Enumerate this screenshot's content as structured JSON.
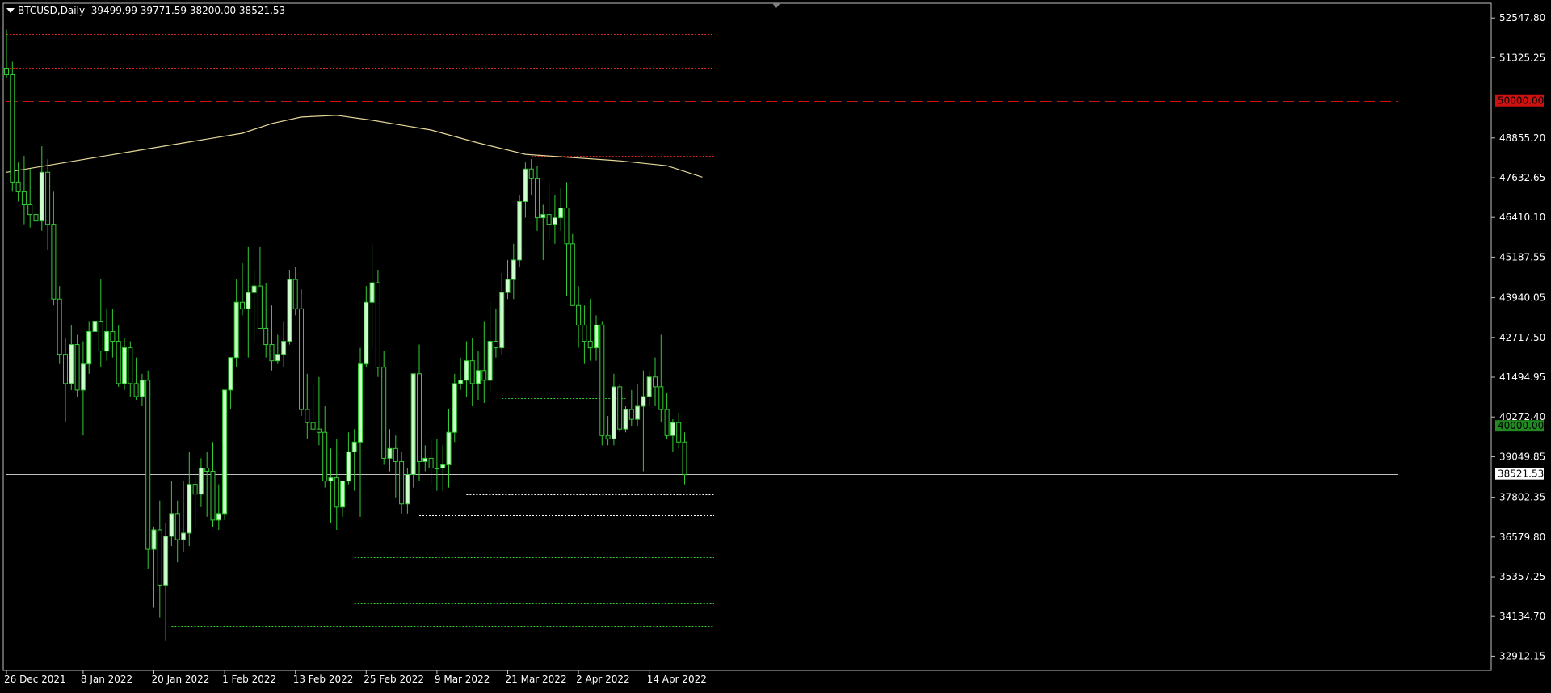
{
  "header": {
    "symbol_label": "BTCUSD,Daily",
    "ohlc_text": "39499.99 39771.59 38200.00 38521.53"
  },
  "colors": {
    "background": "#000000",
    "frame": "#c0c0c0",
    "text": "#ffffff",
    "bull_candle": "#ccffcc",
    "bear_candle": "#000000",
    "wick": "#33cc33",
    "moving_average": "#e6d89a",
    "resistance_line": "#cc2222",
    "support_line": "#33cc33",
    "support_alt_line": "#ffffff",
    "level_50000": "#cc1111",
    "level_40000": "#228822",
    "current_price_line": "#c0c0c0"
  },
  "chart_data": {
    "type": "candlestick",
    "symbol": "BTCUSD",
    "timeframe": "Daily",
    "y_axis_ticks": [
      "52547.80",
      "51325.25",
      "48855.20",
      "47632.65",
      "46410.10",
      "45187.55",
      "43940.05",
      "42717.50",
      "41494.95",
      "40272.40",
      "39049.85",
      "37802.35",
      "36579.80",
      "35357.25",
      "34134.70",
      "32912.15"
    ],
    "ylim": [
      32500,
      53000
    ],
    "x_axis_labels": [
      "26 Dec 2021",
      "8 Jan 2022",
      "20 Jan 2022",
      "1 Feb 2022",
      "13 Feb 2022",
      "25 Feb 2022",
      "9 Mar 2022",
      "21 Mar 2022",
      "2 Apr 2022",
      "14 Apr 2022"
    ],
    "x_label_day_index": [
      0,
      13,
      25,
      37,
      49,
      61,
      73,
      85,
      97,
      109
    ],
    "total_days": 120,
    "price_tags": [
      {
        "name": "level-50000",
        "label": "50000.00",
        "value": 50000
      },
      {
        "name": "level-40000",
        "label": "40000.00",
        "value": 40000
      },
      {
        "name": "current-price",
        "label": "38521.53",
        "value": 38521.53
      }
    ],
    "candles": [
      [
        51000,
        52200,
        50700,
        50800
      ],
      [
        50800,
        51200,
        47200,
        47500
      ],
      [
        47500,
        48100,
        46900,
        47200
      ],
      [
        47200,
        48300,
        46200,
        46800
      ],
      [
        46800,
        47900,
        46100,
        46500
      ],
      [
        46500,
        47300,
        45800,
        46300
      ],
      [
        46300,
        48600,
        46000,
        47800
      ],
      [
        47800,
        48200,
        45400,
        46200
      ],
      [
        46200,
        47200,
        43700,
        43900
      ],
      [
        43900,
        44300,
        41900,
        42200
      ],
      [
        42200,
        42700,
        40100,
        41300
      ],
      [
        41300,
        43100,
        41100,
        42500
      ],
      [
        42500,
        42800,
        40900,
        41100
      ],
      [
        41100,
        42600,
        39700,
        41900
      ],
      [
        41900,
        43200,
        41600,
        42900
      ],
      [
        42900,
        44100,
        42600,
        43200
      ],
      [
        43200,
        44500,
        41800,
        42300
      ],
      [
        42300,
        43600,
        42000,
        42900
      ],
      [
        42900,
        43600,
        42100,
        42600
      ],
      [
        42600,
        43100,
        41200,
        41300
      ],
      [
        41300,
        42700,
        41100,
        42400
      ],
      [
        42400,
        42600,
        40900,
        41300
      ],
      [
        41300,
        42100,
        40800,
        40900
      ],
      [
        40900,
        41600,
        40600,
        41400
      ],
      [
        41400,
        41700,
        35600,
        36200
      ],
      [
        36200,
        36900,
        34400,
        36800
      ],
      [
        36800,
        37700,
        34100,
        35100
      ],
      [
        35100,
        37000,
        33400,
        36600
      ],
      [
        36600,
        38300,
        36300,
        37300
      ],
      [
        37300,
        37700,
        35800,
        36500
      ],
      [
        36500,
        38300,
        36100,
        36700
      ],
      [
        36700,
        39200,
        36300,
        38200
      ],
      [
        38200,
        38600,
        36900,
        37900
      ],
      [
        37900,
        39000,
        37500,
        38700
      ],
      [
        38700,
        39200,
        37200,
        38600
      ],
      [
        38600,
        39500,
        36900,
        37100
      ],
      [
        37100,
        38200,
        36800,
        37300
      ],
      [
        37300,
        41100,
        37100,
        41100
      ],
      [
        41100,
        42000,
        40500,
        42100
      ],
      [
        42100,
        44500,
        41800,
        43800
      ],
      [
        43800,
        45000,
        43400,
        43600
      ],
      [
        43600,
        45500,
        42100,
        44100
      ],
      [
        44100,
        44800,
        42600,
        44300
      ],
      [
        44300,
        45500,
        43200,
        43000
      ],
      [
        43000,
        44400,
        42100,
        42500
      ],
      [
        42500,
        43700,
        41700,
        42000
      ],
      [
        42000,
        42800,
        41900,
        42200
      ],
      [
        42200,
        43200,
        41800,
        42600
      ],
      [
        42600,
        44800,
        42500,
        44500
      ],
      [
        44500,
        44900,
        43400,
        43600
      ],
      [
        43600,
        44200,
        40300,
        40500
      ],
      [
        40500,
        41600,
        39600,
        40100
      ],
      [
        40100,
        41300,
        39800,
        39900
      ],
      [
        39900,
        41500,
        39400,
        39800
      ],
      [
        39800,
        40600,
        38100,
        38300
      ],
      [
        38300,
        39300,
        37000,
        38400
      ],
      [
        38400,
        39600,
        36800,
        37500
      ],
      [
        37500,
        38200,
        37200,
        38300
      ],
      [
        38300,
        39800,
        38200,
        39200
      ],
      [
        39200,
        39900,
        38000,
        39500
      ],
      [
        39500,
        42400,
        37200,
        41900
      ],
      [
        41900,
        44300,
        41800,
        43800
      ],
      [
        43800,
        45600,
        42400,
        44400
      ],
      [
        44400,
        44800,
        41500,
        41800
      ],
      [
        41800,
        42300,
        38800,
        39000
      ],
      [
        39000,
        39900,
        38600,
        39300
      ],
      [
        39300,
        39700,
        37800,
        38900
      ],
      [
        38900,
        39200,
        37300,
        37600
      ],
      [
        37600,
        38700,
        37300,
        38500
      ],
      [
        38500,
        39800,
        38100,
        41600
      ],
      [
        41600,
        42500,
        38300,
        38900
      ],
      [
        38900,
        39400,
        38600,
        39000
      ],
      [
        39000,
        39600,
        38200,
        38700
      ],
      [
        38700,
        39600,
        38000,
        38700
      ],
      [
        38700,
        39400,
        38000,
        38800
      ],
      [
        38800,
        40500,
        38100,
        39800
      ],
      [
        39800,
        41600,
        39500,
        41300
      ],
      [
        41300,
        42100,
        41100,
        41400
      ],
      [
        41400,
        42600,
        40900,
        42000
      ],
      [
        42000,
        42700,
        40600,
        41300
      ],
      [
        41300,
        42300,
        40800,
        41700
      ],
      [
        41700,
        43200,
        40700,
        41400
      ],
      [
        41400,
        43800,
        41000,
        42600
      ],
      [
        42600,
        43600,
        42100,
        42400
      ],
      [
        42400,
        44700,
        42200,
        44100
      ],
      [
        44100,
        45100,
        43900,
        44500
      ],
      [
        44500,
        45600,
        43900,
        45100
      ],
      [
        45100,
        47100,
        44900,
        46900
      ],
      [
        46900,
        48100,
        46400,
        47900
      ],
      [
        47900,
        48200,
        47100,
        47600
      ],
      [
        47600,
        48000,
        46000,
        46400
      ],
      [
        46400,
        46800,
        45100,
        46500
      ],
      [
        46500,
        47500,
        45700,
        46200
      ],
      [
        46200,
        47100,
        45600,
        46400
      ],
      [
        46400,
        47300,
        46000,
        46700
      ],
      [
        46700,
        47500,
        44000,
        45600
      ],
      [
        45600,
        45900,
        43700,
        43700
      ],
      [
        43700,
        44300,
        42400,
        43100
      ],
      [
        43100,
        43700,
        41900,
        42600
      ],
      [
        42600,
        43900,
        42000,
        42400
      ],
      [
        42400,
        43400,
        42000,
        43100
      ],
      [
        43100,
        43200,
        39400,
        39700
      ],
      [
        39700,
        40300,
        39400,
        39600
      ],
      [
        39600,
        41600,
        39400,
        41200
      ],
      [
        41200,
        41300,
        39800,
        39900
      ],
      [
        39900,
        40600,
        39800,
        40500
      ],
      [
        40500,
        41100,
        40000,
        40200
      ],
      [
        40200,
        41300,
        40000,
        40600
      ],
      [
        40600,
        41700,
        38600,
        40900
      ],
      [
        40900,
        41700,
        40600,
        41500
      ],
      [
        41500,
        42100,
        40600,
        41200
      ],
      [
        41200,
        42800,
        40100,
        40500
      ],
      [
        40500,
        41000,
        39600,
        39700
      ],
      [
        39700,
        40200,
        39200,
        40100
      ],
      [
        40100,
        40400,
        39300,
        39500
      ],
      [
        39500,
        39800,
        38200,
        38500
      ]
    ],
    "moving_average": {
      "label": "",
      "points": [
        [
          0,
          47800
        ],
        [
          10,
          48100
        ],
        [
          20,
          48400
        ],
        [
          30,
          48700
        ],
        [
          40,
          49000
        ],
        [
          45,
          49300
        ],
        [
          50,
          49500
        ],
        [
          56,
          49550
        ],
        [
          62,
          49400
        ],
        [
          72,
          49100
        ],
        [
          80,
          48700
        ],
        [
          88,
          48350
        ],
        [
          96,
          48250
        ],
        [
          104,
          48150
        ],
        [
          112,
          48000
        ],
        [
          118,
          47650
        ]
      ]
    },
    "levels": [
      {
        "name": "resistance-top",
        "value": 52050,
        "from": 0,
        "to": 120,
        "kind": "resistance",
        "dash": "dotted"
      },
      {
        "name": "resistance-51",
        "value": 51000,
        "from": 0,
        "to": 120,
        "kind": "resistance",
        "dash": "dotted"
      },
      {
        "name": "level-50000",
        "value": 50000,
        "from": 0,
        "to": 236,
        "kind": "level_50000",
        "dash": "long"
      },
      {
        "name": "resistance-48-upper",
        "value": 48300,
        "from": 89,
        "to": 120,
        "kind": "resistance",
        "dash": "dotted"
      },
      {
        "name": "resistance-48-lower",
        "value": 48000,
        "from": 92,
        "to": 120,
        "kind": "resistance",
        "dash": "dotted"
      },
      {
        "name": "support-41-upper",
        "value": 41550,
        "from": 84,
        "to": 105,
        "kind": "support",
        "dash": "dotted"
      },
      {
        "name": "support-41-lower",
        "value": 40850,
        "from": 84,
        "to": 105,
        "kind": "support",
        "dash": "dotted"
      },
      {
        "name": "level-40000",
        "value": 40000,
        "from": 0,
        "to": 236,
        "kind": "level_40000",
        "dash": "long"
      },
      {
        "name": "current-price",
        "value": 38521.53,
        "from": 0,
        "to": 236,
        "kind": "current_price",
        "dash": "solid"
      },
      {
        "name": "support-37-9",
        "value": 37900,
        "from": 78,
        "to": 120,
        "kind": "support_alt",
        "dash": "dotted"
      },
      {
        "name": "support-37-3",
        "value": 37250,
        "from": 70,
        "to": 120,
        "kind": "support_alt",
        "dash": "dotted"
      },
      {
        "name": "support-36-0",
        "value": 35950,
        "from": 59,
        "to": 120,
        "kind": "support",
        "dash": "dotted"
      },
      {
        "name": "support-34-5",
        "value": 34550,
        "from": 59,
        "to": 120,
        "kind": "support",
        "dash": "dotted"
      },
      {
        "name": "support-33-8",
        "value": 33850,
        "from": 28,
        "to": 120,
        "kind": "support",
        "dash": "dotted"
      },
      {
        "name": "support-33-1",
        "value": 33150,
        "from": 28,
        "to": 120,
        "kind": "support",
        "dash": "dotted"
      }
    ]
  }
}
